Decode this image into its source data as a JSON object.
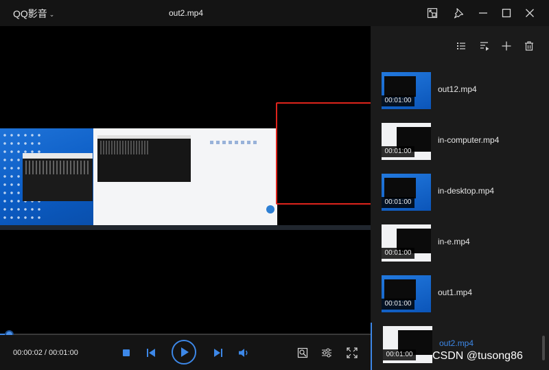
{
  "app": {
    "name": "QQ影音",
    "window_title": "out2.mp4"
  },
  "icons": {
    "minimize": "minimize-icon",
    "maximize": "maximize-icon",
    "close": "close-icon",
    "pin": "pin-icon",
    "mini-mode": "mini-mode-icon"
  },
  "colors": {
    "accent": "#3d88e8",
    "highlight_box": "#e0241c",
    "background": "#000000",
    "panel": "#1b1b1b"
  },
  "player": {
    "time_display": "00:00:02 / 00:01:00",
    "progress": 0.033
  },
  "playlist": {
    "items": [
      {
        "name": "out12.mp4",
        "duration": "00:01:00",
        "thumb": "blue",
        "active": false
      },
      {
        "name": "in-computer.mp4",
        "duration": "00:01:00",
        "thumb": "white",
        "active": false
      },
      {
        "name": "in-desktop.mp4",
        "duration": "00:01:00",
        "thumb": "blue",
        "active": false
      },
      {
        "name": "in-e.mp4",
        "duration": "00:01:00",
        "thumb": "white",
        "active": false
      },
      {
        "name": "out1.mp4",
        "duration": "00:01:00",
        "thumb": "blue",
        "active": false
      },
      {
        "name": "out2.mp4",
        "duration": "00:01:00",
        "thumb": "white",
        "active": true
      }
    ]
  },
  "watermark": "CSDN @tusong86"
}
